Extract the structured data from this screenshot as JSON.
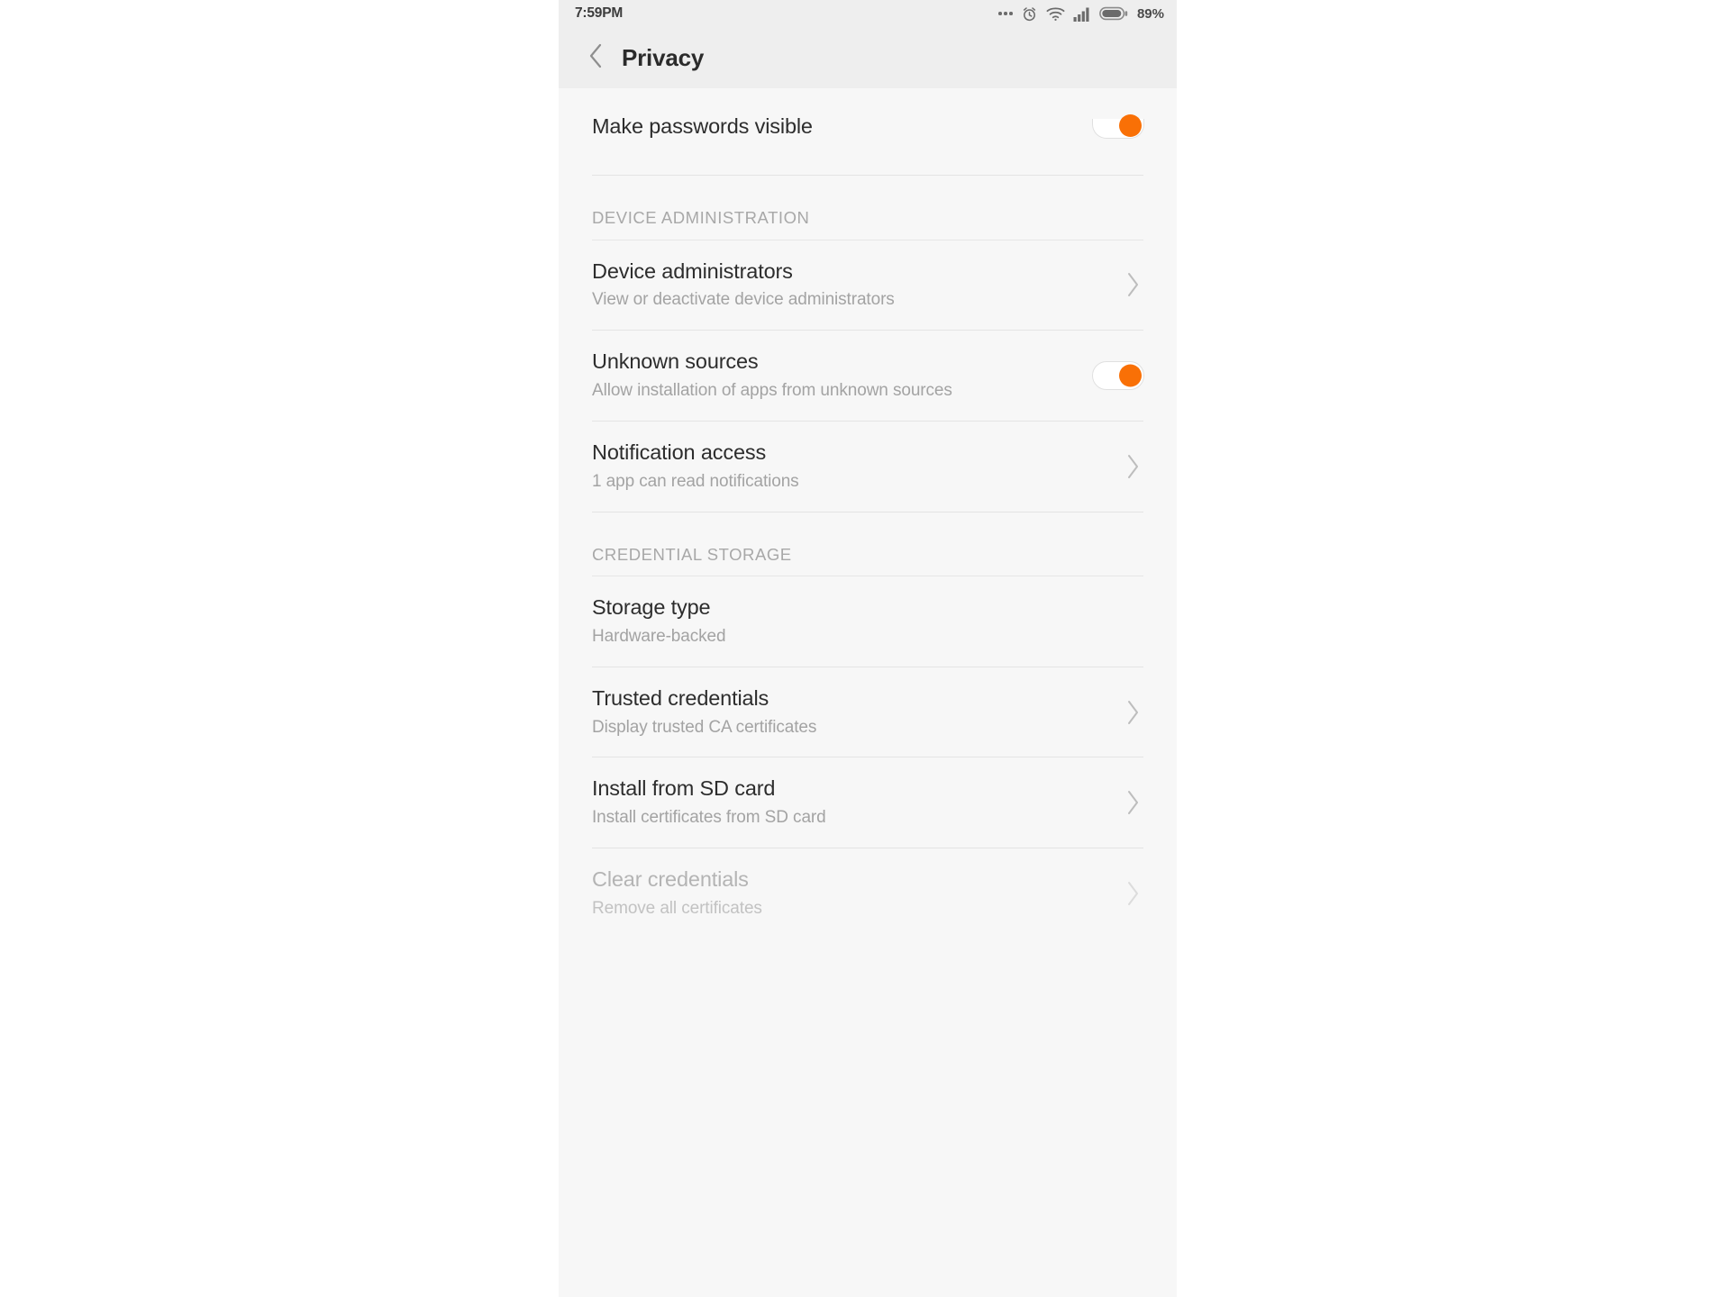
{
  "status_bar": {
    "time": "7:59PM",
    "battery_percent": "89%",
    "icons": [
      "more-dots-icon",
      "alarm-clock-icon",
      "wifi-icon",
      "signal-bars-icon",
      "battery-icon"
    ]
  },
  "app_bar": {
    "back_icon": "chevron-left-icon",
    "title": "Privacy"
  },
  "colors": {
    "accent": "#f97006",
    "screen_bg": "#f7f7f7",
    "bar_bg": "#eeeeee",
    "title_text": "#2d2d2d",
    "subtitle_text": "#a3a3a3",
    "disabled_text": "#b4b4b4",
    "divider": "#e4e4e4"
  },
  "list": {
    "top_partial_row": {
      "title": "Make passwords visible",
      "control": "switch",
      "switch_on": true
    },
    "sections": [
      {
        "header": "DEVICE ADMINISTRATION",
        "rows": [
          {
            "title": "Device administrators",
            "subtitle": "View or deactivate device administrators",
            "control": "chevron",
            "disabled": false
          },
          {
            "title": "Unknown sources",
            "subtitle": "Allow installation of apps from unknown sources",
            "control": "switch",
            "switch_on": true,
            "disabled": false
          },
          {
            "title": "Notification access",
            "subtitle": "1 app can read notifications",
            "control": "chevron",
            "disabled": false
          }
        ]
      },
      {
        "header": "CREDENTIAL STORAGE",
        "rows": [
          {
            "title": "Storage type",
            "subtitle": "Hardware-backed",
            "control": "none",
            "disabled": false
          },
          {
            "title": "Trusted credentials",
            "subtitle": "Display trusted CA certificates",
            "control": "chevron",
            "disabled": false
          },
          {
            "title": "Install from SD card",
            "subtitle": "Install certificates from SD card",
            "control": "chevron",
            "disabled": false
          },
          {
            "title": "Clear credentials",
            "subtitle": "Remove all certificates",
            "control": "chevron",
            "disabled": true
          }
        ]
      }
    ]
  }
}
